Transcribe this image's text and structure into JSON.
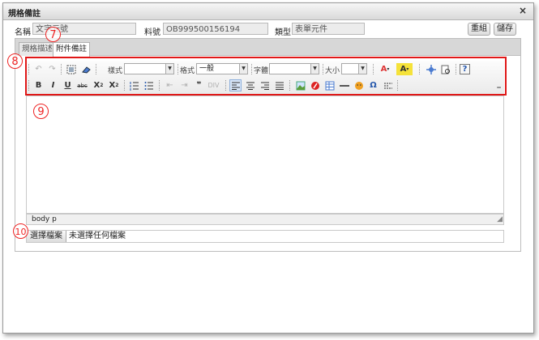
{
  "dialog": {
    "title": "規格備註",
    "close_glyph": "×"
  },
  "form": {
    "name_label": "名稱",
    "name_value": "文字元號",
    "partno_label": "料號",
    "partno_value": "OB999500156194",
    "type_label": "類型",
    "type_value": "表單元件",
    "reset_label": "重組",
    "save_label": "儲存"
  },
  "tabs": [
    {
      "label": "規格描述"
    },
    {
      "label": "附件備註"
    }
  ],
  "toolbar": {
    "style_label": "樣式",
    "style_value": "",
    "format_label": "格式",
    "format_value": "一般",
    "font_label": "字體",
    "font_value": "",
    "size_label": "大小",
    "size_value": ""
  },
  "editor": {
    "status_path": "body  p"
  },
  "file": {
    "button_label": "選擇檔案",
    "status_text": "未選擇任何檔案"
  },
  "annotations": {
    "badge_7": "7",
    "badge_8": "8",
    "badge_9": "9",
    "badge_10": "10"
  },
  "colors": {
    "annotation_red": "#e01818"
  }
}
